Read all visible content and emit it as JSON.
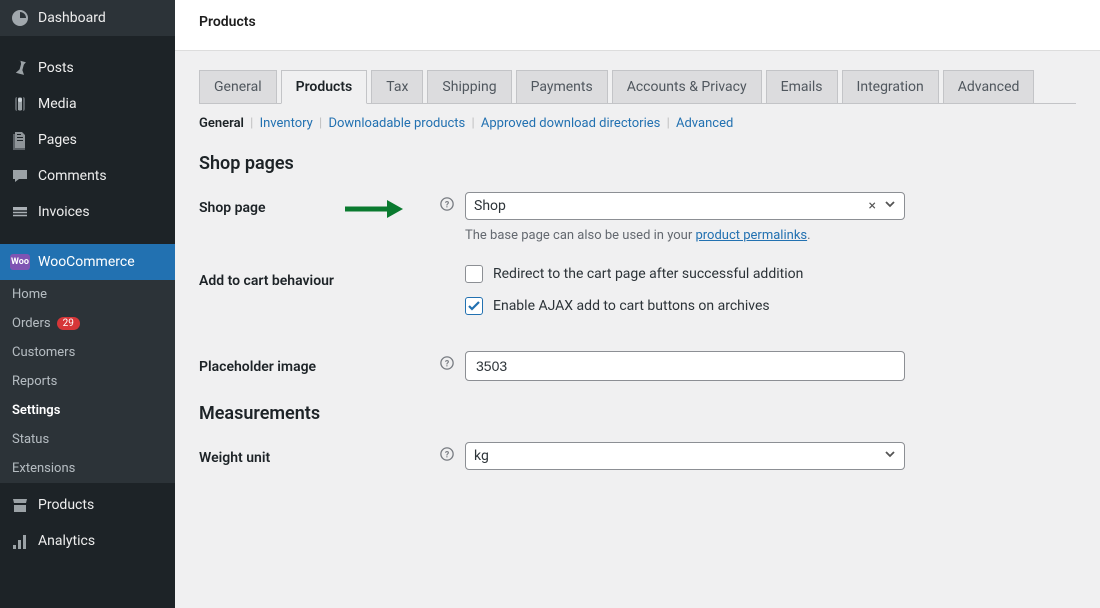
{
  "sidebar": {
    "main_items": [
      {
        "label": "Dashboard",
        "icon": "dashboard-icon"
      },
      {
        "label": "Posts",
        "icon": "pin-icon"
      },
      {
        "label": "Media",
        "icon": "media-icon"
      },
      {
        "label": "Pages",
        "icon": "pages-icon"
      },
      {
        "label": "Comments",
        "icon": "comments-icon"
      },
      {
        "label": "Invoices",
        "icon": "invoices-icon"
      }
    ],
    "woo_label": "WooCommerce",
    "woo_sub": [
      {
        "label": "Home"
      },
      {
        "label": "Orders",
        "badge": "29"
      },
      {
        "label": "Customers"
      },
      {
        "label": "Reports"
      },
      {
        "label": "Settings",
        "current": true
      },
      {
        "label": "Status"
      },
      {
        "label": "Extensions"
      }
    ],
    "tail_items": [
      {
        "label": "Products",
        "icon": "products-icon"
      },
      {
        "label": "Analytics",
        "icon": "analytics-icon"
      }
    ]
  },
  "header": {
    "title": "Products"
  },
  "tabs": [
    {
      "label": "General"
    },
    {
      "label": "Products",
      "active": true
    },
    {
      "label": "Tax"
    },
    {
      "label": "Shipping"
    },
    {
      "label": "Payments"
    },
    {
      "label": "Accounts & Privacy"
    },
    {
      "label": "Emails"
    },
    {
      "label": "Integration"
    },
    {
      "label": "Advanced"
    }
  ],
  "subtabs": [
    {
      "label": "General",
      "active": true
    },
    {
      "label": "Inventory"
    },
    {
      "label": "Downloadable products"
    },
    {
      "label": "Approved download directories"
    },
    {
      "label": "Advanced"
    }
  ],
  "sections": {
    "shop_pages_title": "Shop pages",
    "measurements_title": "Measurements"
  },
  "fields": {
    "shop_page": {
      "label": "Shop page",
      "value": "Shop",
      "hint_prefix": "The base page can also be used in your ",
      "hint_link": "product permalinks",
      "hint_suffix": "."
    },
    "add_to_cart": {
      "label": "Add to cart behaviour",
      "redirect_label": "Redirect to the cart page after successful addition",
      "redirect_checked": false,
      "ajax_label": "Enable AJAX add to cart buttons on archives",
      "ajax_checked": true
    },
    "placeholder_image": {
      "label": "Placeholder image",
      "value": "3503"
    },
    "weight_unit": {
      "label": "Weight unit",
      "value": "kg"
    }
  }
}
